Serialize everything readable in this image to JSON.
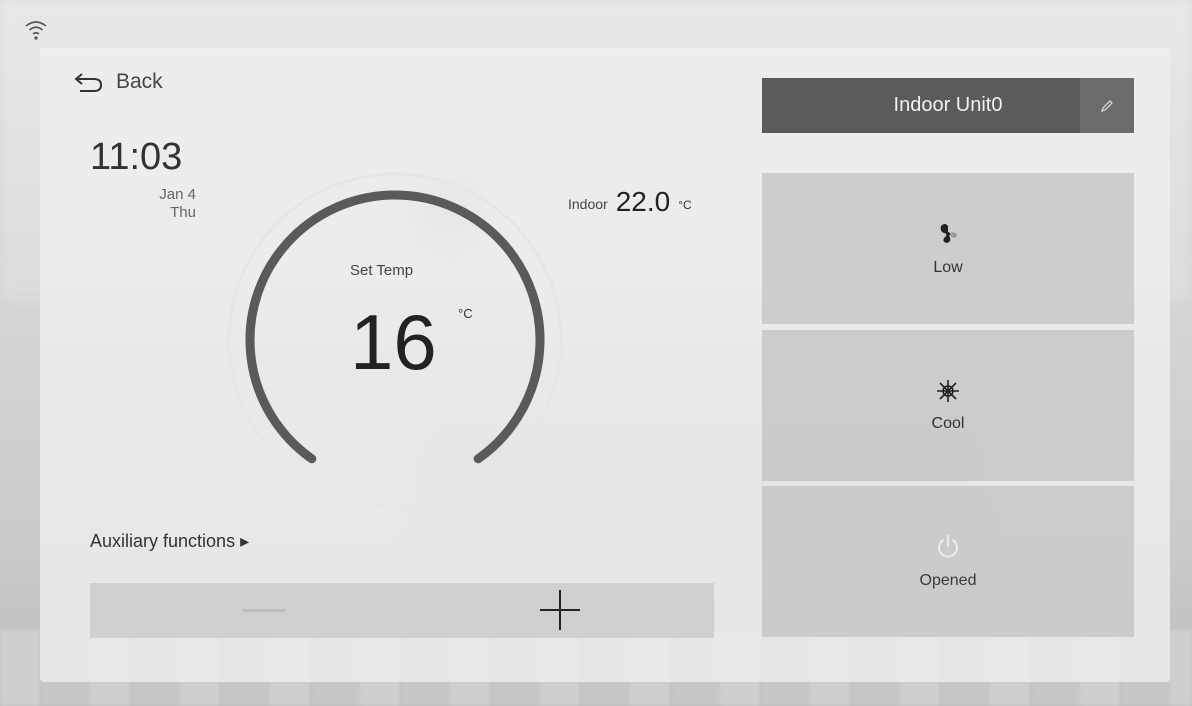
{
  "header": {
    "back_label": "Back"
  },
  "clock": {
    "time": "11:03",
    "date": "Jan 4",
    "weekday": "Thu"
  },
  "setpoint": {
    "label": "Set Temp",
    "value": "16",
    "unit": "°C"
  },
  "indoor": {
    "label": "Indoor",
    "value": "22.0",
    "unit": "°C"
  },
  "auxiliary": {
    "label": "Auxiliary functions ▸"
  },
  "unit": {
    "name": "Indoor Unit0"
  },
  "cards": {
    "fan": {
      "label": "Low",
      "icon": "fan-icon"
    },
    "mode": {
      "label": "Cool",
      "icon": "snowflake-icon"
    },
    "power": {
      "label": "Opened",
      "icon": "power-icon"
    }
  },
  "colors": {
    "dial": "#5a5a5a",
    "unit_bar": "#5b5b5b"
  }
}
